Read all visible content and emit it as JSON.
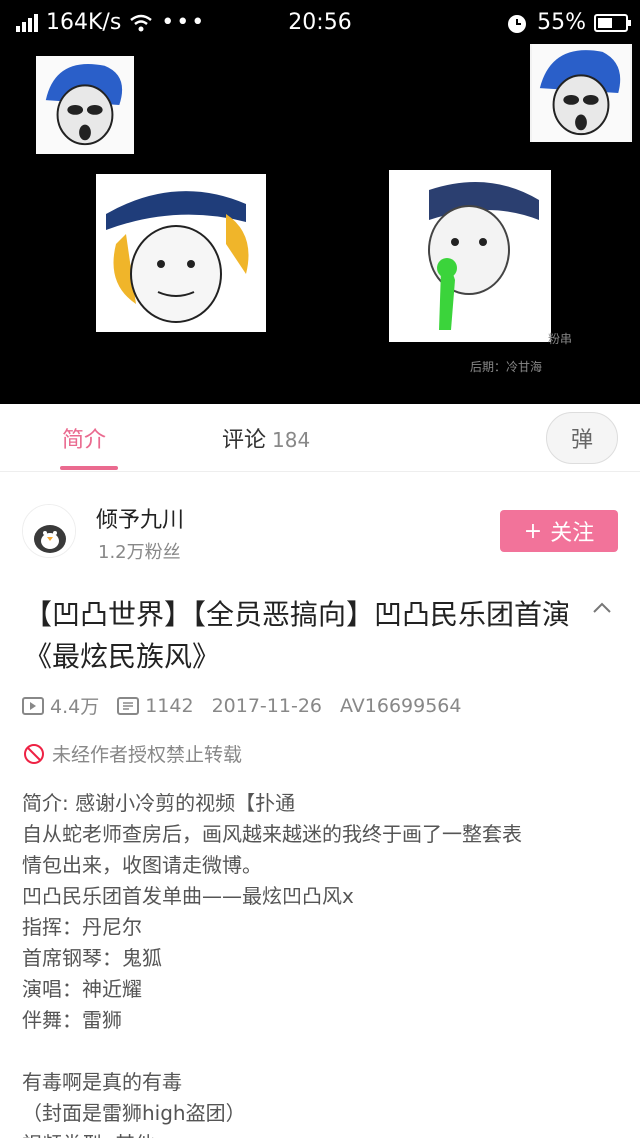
{
  "status_bar": {
    "speed": "164K/s",
    "time": "20:56",
    "battery_pct": "55%",
    "battery_level": 0.55,
    "icons": [
      "signal-icon",
      "wifi-icon",
      "more-icon",
      "alarm-icon",
      "battery-icon"
    ]
  },
  "video": {
    "watermark_1": "粉串",
    "watermark_2": "后期：冷甘海"
  },
  "tabs": {
    "intro": "简介",
    "comments": "评论",
    "comments_count": "184",
    "danmaku": "弹"
  },
  "uploader": {
    "name": "倾予九川",
    "fans": "1.2万粉丝",
    "follow_label": "关注",
    "follow_plus": "+"
  },
  "video_info": {
    "title": "【凹凸世界】【全员恶搞向】凹凸民乐团首演《最炫民族风》",
    "views": "4.4万",
    "danmaku_count": "1142",
    "date": "2017-11-26",
    "av": "AV16699564",
    "copyright": "未经作者授权禁止转载"
  },
  "description": [
    "简介: 感谢小冷剪的视频【扑通",
    "自从蛇老师查房后，画风越来越迷的我终于画了一整套表",
    "情包出来，收图请走微博。",
    "凹凸民乐团首发单曲——最炫凹凸风x",
    "指挥：丹尼尔",
    "首席钢琴：鬼狐",
    "演唱：神近耀",
    "伴舞：雷狮",
    "",
    "有毒啊是真的有毒",
    "（封面是雷狮high盗团）",
    "视频类型: 其他"
  ],
  "colors": {
    "accent": "#ea6a8f",
    "follow_bg": "#f2739a"
  }
}
